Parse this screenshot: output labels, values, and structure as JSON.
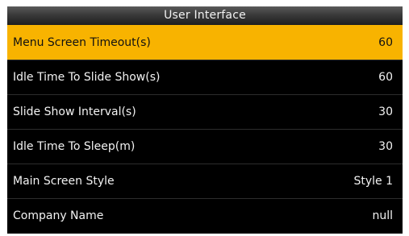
{
  "window": {
    "title": "User Interface"
  },
  "colors": {
    "selected_background": "#f8b300",
    "screen_background": "#000000",
    "text": "#f2f2f2"
  },
  "menu": {
    "selected_index": 0,
    "items": [
      {
        "label": "Menu Screen Timeout(s)",
        "value": "60"
      },
      {
        "label": "Idle Time To Slide Show(s)",
        "value": "60"
      },
      {
        "label": "Slide Show Interval(s)",
        "value": "30"
      },
      {
        "label": "Idle Time To Sleep(m)",
        "value": "30"
      },
      {
        "label": "Main Screen Style",
        "value": "Style 1"
      },
      {
        "label": "Company Name",
        "value": "null"
      }
    ]
  }
}
